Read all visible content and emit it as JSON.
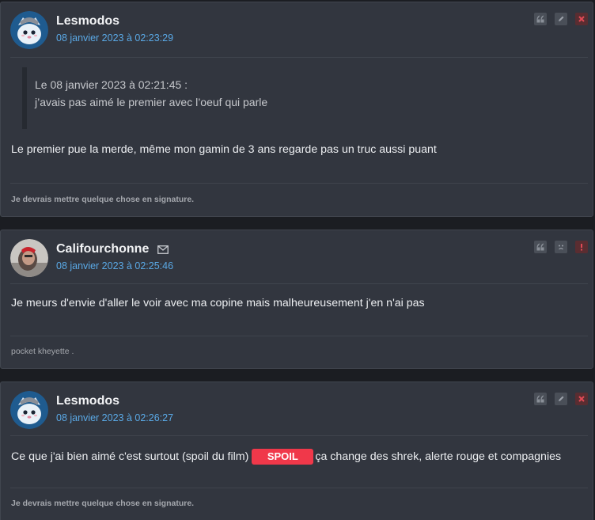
{
  "colors": {
    "accent_date": "#5aa9e6",
    "spoil_bg": "#f0384a",
    "card_bg": "#32363f"
  },
  "posts": [
    {
      "author": "Lesmodos",
      "date": "08 janvier 2023 à 02:23:29",
      "quote": {
        "header": "Le 08 janvier 2023 à 02:21:45 :",
        "text": "j’avais pas aimé le premier avec l’oeuf qui parle"
      },
      "message": "Le premier pue la merde, même mon gamin de 3 ans regarde pas un truc aussi puant",
      "signature": "Je devrais mettre quelque chose en signature.",
      "actions": [
        "quote-icon",
        "edit-icon",
        "delete-icon"
      ]
    },
    {
      "author": "Califourchonne",
      "date": "08 janvier 2023 à 02:25:46",
      "message": "Je meurs d'envie d'aller le voir avec ma copine mais malheureusement j'en n'ai pas",
      "signature": "pocket kheyette .",
      "actions": [
        "quote-icon",
        "sad-face-icon",
        "report-icon"
      ]
    },
    {
      "author": "Lesmodos",
      "date": "08 janvier 2023 à 02:26:27",
      "message_before": "Ce que j'ai bien aimé c'est surtout (spoil du film)",
      "spoil_label": "SPOIL",
      "message_after": "ça change des shrek, alerte rouge et compagnies",
      "signature": "Je devrais mettre quelque chose en signature.",
      "actions": [
        "quote-icon",
        "edit-icon",
        "delete-icon"
      ]
    }
  ]
}
